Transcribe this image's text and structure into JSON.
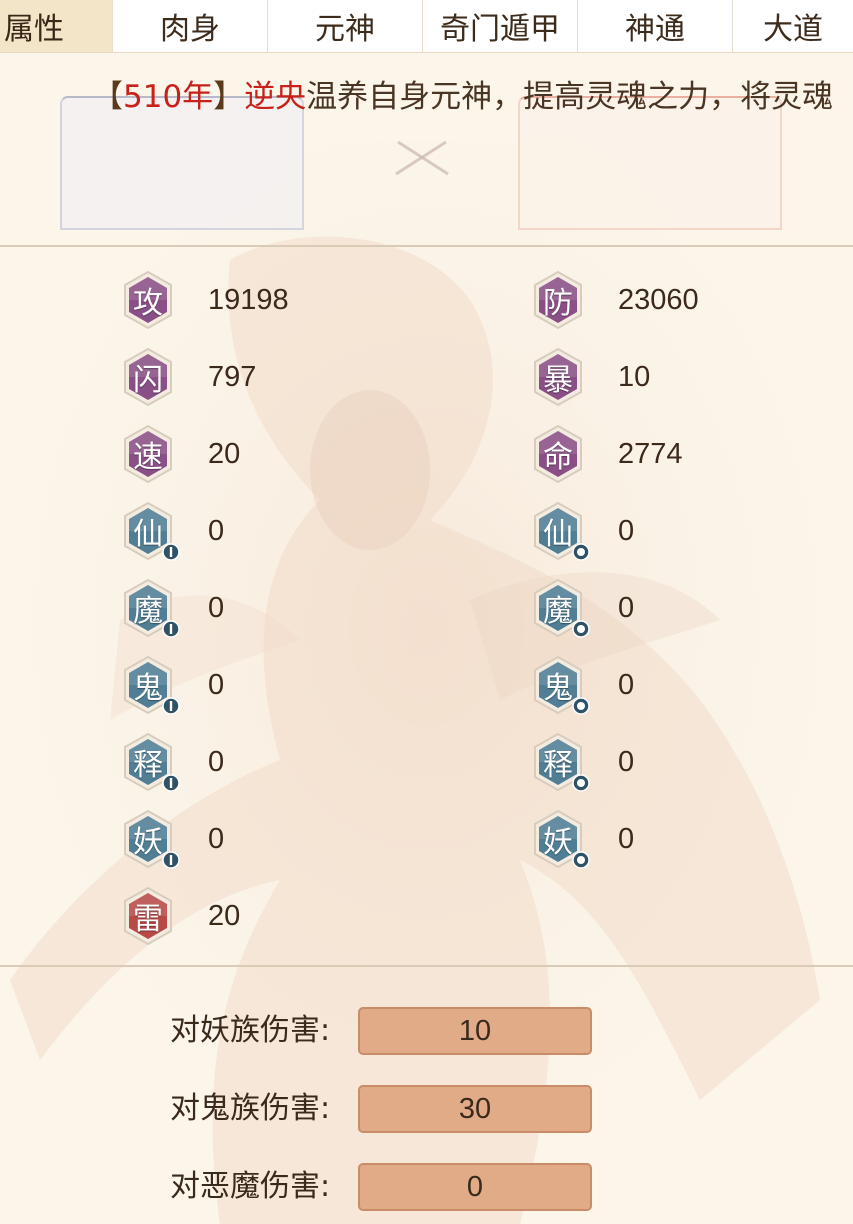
{
  "tabs": [
    "属性",
    "肉身",
    "元神",
    "奇门遁甲",
    "神通",
    "大道"
  ],
  "log": {
    "open_bracket": "【",
    "year": "510年",
    "close_bracket": "】",
    "name": "逆央",
    "text": "温养自身元神，提高灵魂之力，将灵魂"
  },
  "stats_left": [
    {
      "glyph": "攻",
      "value": "19198",
      "color": "#8a4f86",
      "icon": "attack-icon"
    },
    {
      "glyph": "闪",
      "value": "797",
      "color": "#8a4f86",
      "icon": "dodge-icon"
    },
    {
      "glyph": "速",
      "value": "20",
      "color": "#8a4f86",
      "icon": "speed-icon"
    },
    {
      "glyph": "仙",
      "value": "0",
      "color": "#4f7e95",
      "icon": "immortal-attack-icon"
    },
    {
      "glyph": "魔",
      "value": "0",
      "color": "#4f7e95",
      "icon": "demon-attack-icon"
    },
    {
      "glyph": "鬼",
      "value": "0",
      "color": "#4f7e95",
      "icon": "ghost-attack-icon"
    },
    {
      "glyph": "释",
      "value": "0",
      "color": "#4f7e95",
      "icon": "buddha-attack-icon"
    },
    {
      "glyph": "妖",
      "value": "0",
      "color": "#4f7e95",
      "icon": "monster-attack-icon"
    },
    {
      "glyph": "雷",
      "value": "20",
      "color": "#b84a48",
      "icon": "thunder-icon"
    }
  ],
  "stats_right": [
    {
      "glyph": "防",
      "value": "23060",
      "color": "#8a4f86",
      "icon": "defense-icon"
    },
    {
      "glyph": "暴",
      "value": "10",
      "color": "#8a4f86",
      "icon": "critical-icon"
    },
    {
      "glyph": "命",
      "value": "2774",
      "color": "#8a4f86",
      "icon": "health-icon"
    },
    {
      "glyph": "仙",
      "value": "0",
      "color": "#4f7e95",
      "icon": "immortal-defense-icon"
    },
    {
      "glyph": "魔",
      "value": "0",
      "color": "#4f7e95",
      "icon": "demon-defense-icon"
    },
    {
      "glyph": "鬼",
      "value": "0",
      "color": "#4f7e95",
      "icon": "ghost-defense-icon"
    },
    {
      "glyph": "释",
      "value": "0",
      "color": "#4f7e95",
      "icon": "buddha-defense-icon"
    },
    {
      "glyph": "妖",
      "value": "0",
      "color": "#4f7e95",
      "icon": "monster-defense-icon"
    }
  ],
  "damage": [
    {
      "label": "对妖族伤害:",
      "value": "10"
    },
    {
      "label": "对鬼族伤害:",
      "value": "30"
    },
    {
      "label": "对恶魔伤害:",
      "value": "0"
    }
  ]
}
